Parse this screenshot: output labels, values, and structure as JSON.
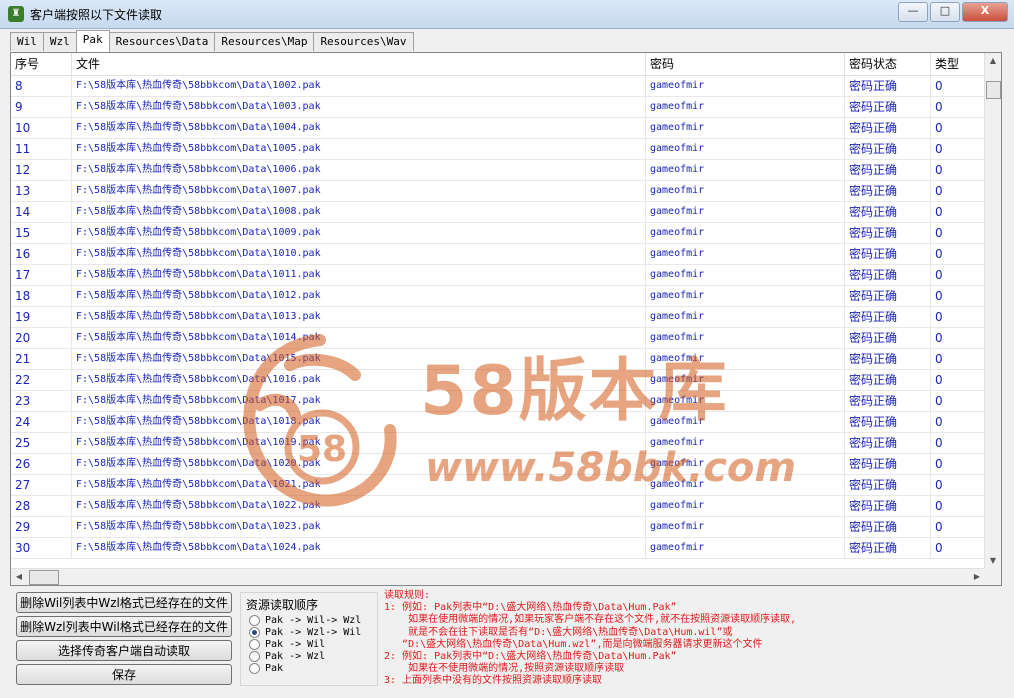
{
  "window": {
    "title": "客户端按照以下文件读取",
    "minimize": "—",
    "maximize": "□",
    "close": "X"
  },
  "tabs": [
    {
      "label": "Wil",
      "active": false
    },
    {
      "label": "Wzl",
      "active": false
    },
    {
      "label": "Pak",
      "active": true
    },
    {
      "label": "Resources\\Data",
      "active": false
    },
    {
      "label": "Resources\\Map",
      "active": false
    },
    {
      "label": "Resources\\Wav",
      "active": false
    }
  ],
  "table": {
    "headers": [
      "序号",
      "文件",
      "密码",
      "密码状态",
      "类型"
    ],
    "rows": [
      [
        "8",
        "F:\\58版本库\\热血传奇\\58bbkcom\\Data\\1002.pak",
        "gameofmir",
        "密码正确",
        "0"
      ],
      [
        "9",
        "F:\\58版本库\\热血传奇\\58bbkcom\\Data\\1003.pak",
        "gameofmir",
        "密码正确",
        "0"
      ],
      [
        "10",
        "F:\\58版本库\\热血传奇\\58bbkcom\\Data\\1004.pak",
        "gameofmir",
        "密码正确",
        "0"
      ],
      [
        "11",
        "F:\\58版本库\\热血传奇\\58bbkcom\\Data\\1005.pak",
        "gameofmir",
        "密码正确",
        "0"
      ],
      [
        "12",
        "F:\\58版本库\\热血传奇\\58bbkcom\\Data\\1006.pak",
        "gameofmir",
        "密码正确",
        "0"
      ],
      [
        "13",
        "F:\\58版本库\\热血传奇\\58bbkcom\\Data\\1007.pak",
        "gameofmir",
        "密码正确",
        "0"
      ],
      [
        "14",
        "F:\\58版本库\\热血传奇\\58bbkcom\\Data\\1008.pak",
        "gameofmir",
        "密码正确",
        "0"
      ],
      [
        "15",
        "F:\\58版本库\\热血传奇\\58bbkcom\\Data\\1009.pak",
        "gameofmir",
        "密码正确",
        "0"
      ],
      [
        "16",
        "F:\\58版本库\\热血传奇\\58bbkcom\\Data\\1010.pak",
        "gameofmir",
        "密码正确",
        "0"
      ],
      [
        "17",
        "F:\\58版本库\\热血传奇\\58bbkcom\\Data\\1011.pak",
        "gameofmir",
        "密码正确",
        "0"
      ],
      [
        "18",
        "F:\\58版本库\\热血传奇\\58bbkcom\\Data\\1012.pak",
        "gameofmir",
        "密码正确",
        "0"
      ],
      [
        "19",
        "F:\\58版本库\\热血传奇\\58bbkcom\\Data\\1013.pak",
        "gameofmir",
        "密码正确",
        "0"
      ],
      [
        "20",
        "F:\\58版本库\\热血传奇\\58bbkcom\\Data\\1014.pak",
        "gameofmir",
        "密码正确",
        "0"
      ],
      [
        "21",
        "F:\\58版本库\\热血传奇\\58bbkcom\\Data\\1015.pak",
        "gameofmir",
        "密码正确",
        "0"
      ],
      [
        "22",
        "F:\\58版本库\\热血传奇\\58bbkcom\\Data\\1016.pak",
        "gameofmir",
        "密码正确",
        "0"
      ],
      [
        "23",
        "F:\\58版本库\\热血传奇\\58bbkcom\\Data\\1017.pak",
        "gameofmir",
        "密码正确",
        "0"
      ],
      [
        "24",
        "F:\\58版本库\\热血传奇\\58bbkcom\\Data\\1018.pak",
        "gameofmir",
        "密码正确",
        "0"
      ],
      [
        "25",
        "F:\\58版本库\\热血传奇\\58bbkcom\\Data\\1019.pak",
        "gameofmir",
        "密码正确",
        "0"
      ],
      [
        "26",
        "F:\\58版本库\\热血传奇\\58bbkcom\\Data\\1020.pak",
        "gameofmir",
        "密码正确",
        "0"
      ],
      [
        "27",
        "F:\\58版本库\\热血传奇\\58bbkcom\\Data\\1021.pak",
        "gameofmir",
        "密码正确",
        "0"
      ],
      [
        "28",
        "F:\\58版本库\\热血传奇\\58bbkcom\\Data\\1022.pak",
        "gameofmir",
        "密码正确",
        "0"
      ],
      [
        "29",
        "F:\\58版本库\\热血传奇\\58bbkcom\\Data\\1023.pak",
        "gameofmir",
        "密码正确",
        "0"
      ],
      [
        "30",
        "F:\\58版本库\\热血传奇\\58bbkcom\\Data\\1024.pak",
        "gameofmir",
        "密码正确",
        "0"
      ]
    ]
  },
  "buttons": {
    "delete_wil": "删除Wil列表中Wzl格式已经存在的文件",
    "delete_wzl": "删除Wzl列表中Wil格式已经存在的文件",
    "select_client": "选择传奇客户端自动读取",
    "save": "保存"
  },
  "read_order": {
    "title": "资源读取顺序",
    "options": [
      {
        "label": "Pak -> Wil-> Wzl",
        "checked": false
      },
      {
        "label": "Pak -> Wzl-> Wil",
        "checked": true
      },
      {
        "label": "Pak -> Wil",
        "checked": false
      },
      {
        "label": "Pak -> Wzl",
        "checked": false
      },
      {
        "label": "Pak",
        "checked": false
      }
    ]
  },
  "rules": {
    "lines": [
      "读取规则:",
      "1: 例如: Pak列表中“D:\\盛大网络\\热血传奇\\Data\\Hum.Pak”",
      "    如果在使用微端的情况,如果玩家客户端不存在这个文件,就不在按照资源读取顺序读取,",
      "    就是不会在往下读取是否有“D:\\盛大网络\\热血传奇\\Data\\Hum.wil”或",
      "   “D:\\盛大网络\\热血传奇\\Data\\Hum.wzl”,而是向微端服务器请求更新这个文件",
      "2: 例如: Pak列表中“D:\\盛大网络\\热血传奇\\Data\\Hum.Pak”",
      "    如果在不使用微端的情况,按照资源读取顺序读取",
      "3: 上面列表中没有的文件按照资源读取顺序读取"
    ]
  },
  "watermark": {
    "brand": "58版本库",
    "url": "www.58bbk.com",
    "emblem": "58"
  },
  "colors": {
    "cell_text": "#1a24b8",
    "rules_text": "#e01b1b",
    "watermark": "#d35a1a"
  }
}
